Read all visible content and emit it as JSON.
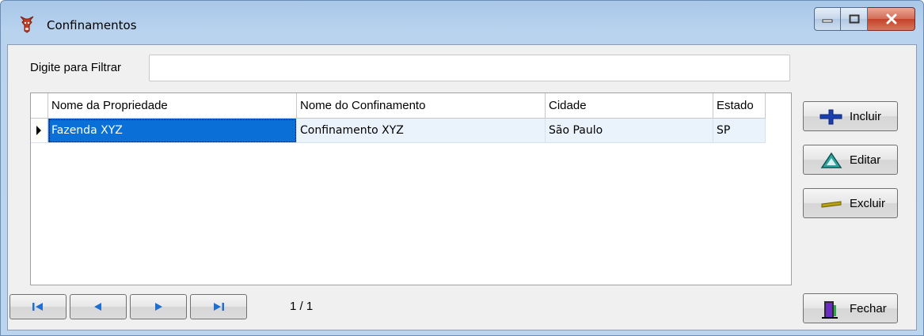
{
  "window": {
    "title": "Confinamentos",
    "icon": "cattle-icon"
  },
  "filter": {
    "label": "Digite para Filtrar",
    "value": "",
    "placeholder": ""
  },
  "grid": {
    "columns": [
      "Nome da Propriedade",
      "Nome do Confinamento",
      "Cidade",
      "Estado"
    ],
    "rows": [
      [
        "Fazenda XYZ",
        "Confinamento XYZ",
        "São Paulo",
        "SP"
      ]
    ]
  },
  "buttons": {
    "incluir": "Incluir",
    "editar": "Editar",
    "excluir": "Excluir",
    "fechar": "Fechar"
  },
  "navigation": {
    "page_info": "1 / 1",
    "icons": [
      "first-icon",
      "prev-icon",
      "next-icon",
      "last-icon"
    ]
  },
  "colors": {
    "selection": "#0a6fd6",
    "row_background": "#eaf3fb",
    "nav_icon": "#1f6fd0"
  }
}
